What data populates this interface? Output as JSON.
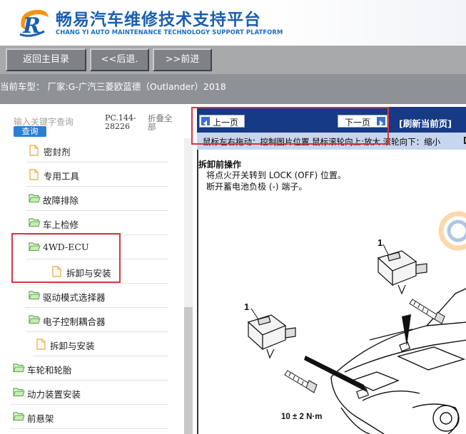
{
  "header": {
    "title_cn": "畅易汽车维修技术支持平台",
    "title_en": "CHANG YI AUTO MAINTENANCE TECHNOLOGY SUPPORT PLATFORM",
    "logo_icon": "cy-logo-icon",
    "brand_blue": "#1a5fb0",
    "brand_orange": "#f29418"
  },
  "nav": {
    "home_label": "返回主目录",
    "back_label": "<<后退.",
    "forward_label": ">>前进"
  },
  "car": {
    "current_model": "当前车型： 厂家:G-广汽三菱欧蓝德（Outlander）2018"
  },
  "sidebar": {
    "search_placeholder": "输入关键字查询",
    "search_button": "查询",
    "pc_code": "PC.144-28226",
    "collapse_all": "折叠全部",
    "items": [
      {
        "label": "密封剂",
        "icon": "document-icon"
      },
      {
        "label": "专用工具",
        "icon": "document-icon"
      },
      {
        "label": "故障排除",
        "icon": "folder-open-icon"
      },
      {
        "label": "车上检修",
        "icon": "folder-open-icon"
      },
      {
        "label": "4WD-ECU",
        "icon": "folder-open-icon"
      },
      {
        "label": "拆卸与安装",
        "icon": "document-icon"
      },
      {
        "label": "驱动模式选择器",
        "icon": "folder-open-icon"
      },
      {
        "label": "电子控制耦合器",
        "icon": "folder-open-icon"
      },
      {
        "label": "拆卸与安装",
        "icon": "document-icon"
      },
      {
        "label": "车轮和轮胎",
        "icon": "folder-open-icon"
      },
      {
        "label": "动力装置安装",
        "icon": "folder-open-icon"
      },
      {
        "label": "前悬架",
        "icon": "folder-open-icon"
      }
    ]
  },
  "viewer": {
    "prev_label": "上一页",
    "next_label": "下一页",
    "refresh_label": "[刷新当前页]",
    "hint": "鼠标左右拖动：控制图片位置  鼠标滚轮向上:放大  滚轮向下：缩小",
    "content": {
      "heading": "拆卸前操作",
      "step1": "将点火开关转到 LOCK (OFF) 位置。",
      "step2": "断开蓄电池负极 (-) 端子。",
      "diagram": {
        "callout_top": "1",
        "callout_left": "1",
        "torque": "10 ± 2 N·m"
      }
    }
  }
}
